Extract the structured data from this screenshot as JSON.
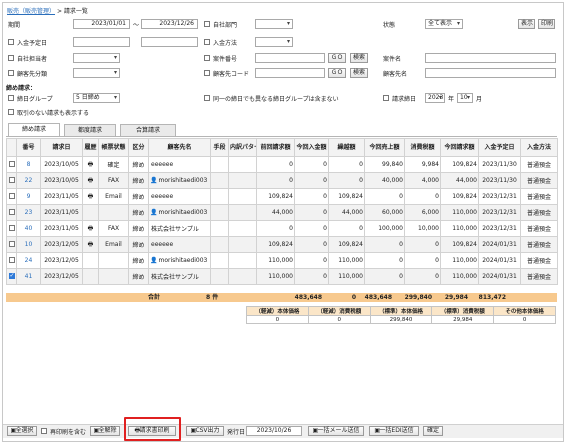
{
  "breadcrumb": {
    "root": "販売（販売管理）",
    "separator": ">",
    "current": "請求一覧"
  },
  "filters": {
    "period_label": "期間",
    "period_from": "2023/01/01",
    "period_tilde": "～",
    "period_to": "2023/12/26",
    "own_dept_label": "自社部門",
    "status_label": "状態",
    "status_value": "全て表示",
    "show_button": "表示",
    "print_button": "印刷",
    "payment_due_label": "入金予定日",
    "payment_method_label": "入金方法",
    "own_staff_label": "自社担当者",
    "case_no_label": "案件番号",
    "go_label": "ＧＯ",
    "search_label": "検索",
    "case_name_label": "案件名",
    "customer_class_label": "顧客先分類",
    "customer_code_label": "顧客先コード",
    "customer_name_label": "顧客先名",
    "closing_title": "締め請求：",
    "closing_group_label": "締日グループ",
    "closing_group_value": "5 日締め",
    "same_closing_label": "同一の締日でも異なる締日グループは含まない",
    "billing_closing_label": "請求締日",
    "year_value": "2023",
    "year_unit": "年",
    "month_value": "10",
    "month_unit": "月",
    "no_transaction_label": "取引のない請求も表示する"
  },
  "tabs": [
    "締め請求",
    "都度請求",
    "合算請求"
  ],
  "table": {
    "headers": [
      "",
      "番号",
      "請求日",
      "履歴",
      "帳票状態",
      "区分",
      "顧客先名",
      "手段",
      "内訳パターン",
      "前回請求額",
      "今回入金額",
      "繰越額",
      "今回売上額",
      "消費税額",
      "今回請求額",
      "入金予定日",
      "入金方法"
    ],
    "rows": [
      {
        "no": "8",
        "date": "2023/10/05",
        "hist": "🖶",
        "state": "確定",
        "div": "締め",
        "icon": "",
        "customer": "eeeeee",
        "prev": "0",
        "paid": "0",
        "carry": "0",
        "sales": "99,840",
        "tax": "9,984",
        "bill": "109,824",
        "due": "2023/11/30",
        "method": "普通預金"
      },
      {
        "no": "22",
        "date": "2023/10/05",
        "hist": "🖶",
        "state": "FAX",
        "div": "締め",
        "icon": "👤",
        "customer": "morishitaedi003",
        "prev": "0",
        "paid": "0",
        "carry": "0",
        "sales": "40,000",
        "tax": "4,000",
        "bill": "44,000",
        "due": "2023/11/30",
        "method": "普通預金"
      },
      {
        "no": "9",
        "date": "2023/11/05",
        "hist": "🖶",
        "state": "Email",
        "div": "締め",
        "icon": "",
        "customer": "eeeeee",
        "prev": "109,824",
        "paid": "0",
        "carry": "109,824",
        "sales": "0",
        "tax": "0",
        "bill": "109,824",
        "due": "2023/12/31",
        "method": "普通預金"
      },
      {
        "no": "23",
        "date": "2023/11/05",
        "hist": "",
        "state": "",
        "div": "締め",
        "icon": "👤",
        "customer": "morishitaedi003",
        "prev": "44,000",
        "paid": "0",
        "carry": "44,000",
        "sales": "60,000",
        "tax": "6,000",
        "bill": "110,000",
        "due": "2023/12/31",
        "method": "普通預金"
      },
      {
        "no": "40",
        "date": "2023/11/05",
        "hist": "🖶",
        "state": "FAX",
        "div": "締め",
        "icon": "",
        "customer": "株式会社サンプル",
        "prev": "0",
        "paid": "0",
        "carry": "0",
        "sales": "100,000",
        "tax": "10,000",
        "bill": "110,000",
        "due": "2023/12/31",
        "method": "普通預金"
      },
      {
        "no": "10",
        "date": "2023/12/05",
        "hist": "🖶",
        "state": "Email",
        "div": "締め",
        "icon": "",
        "customer": "eeeeee",
        "prev": "109,824",
        "paid": "0",
        "carry": "109,824",
        "sales": "0",
        "tax": "0",
        "bill": "109,824",
        "due": "2024/01/31",
        "method": "普通預金"
      },
      {
        "no": "24",
        "date": "2023/12/05",
        "hist": "",
        "state": "",
        "div": "締め",
        "icon": "👤",
        "customer": "morishitaedi003",
        "prev": "110,000",
        "paid": "0",
        "carry": "110,000",
        "sales": "0",
        "tax": "0",
        "bill": "110,000",
        "due": "2024/01/31",
        "method": "普通預金"
      },
      {
        "no": "41",
        "date": "2023/12/05",
        "hist": "",
        "state": "",
        "div": "締め",
        "icon": "",
        "customer": "株式会社サンプル",
        "prev": "110,000",
        "paid": "0",
        "carry": "110,000",
        "sales": "0",
        "tax": "0",
        "bill": "110,000",
        "due": "2024/01/31",
        "method": "普通預金"
      }
    ]
  },
  "totals": {
    "label": "合計",
    "count": "8 件",
    "prev": "483,648",
    "paid": "0",
    "carry": "483,648",
    "sales": "299,840",
    "tax": "29,984",
    "bill": "813,472"
  },
  "summary": {
    "headers": [
      "（軽減）本体価格",
      "（軽減）消費税額",
      "（標準）本体価格",
      "（標準）消費税額",
      "その他本体価格"
    ],
    "values": [
      "0",
      "0",
      "299,840",
      "29,984",
      "0"
    ]
  },
  "bottom": {
    "select_all": "全選択",
    "include_reissue": "再印刷を含む",
    "deselect_all": "全解除",
    "print_invoice": "請求書印刷",
    "csv_export": "CSV出力",
    "issue_date_label": "発行日",
    "issue_date": "2023/10/26",
    "batch_mail": "一括メール送信",
    "batch_edi": "一括EDI送信",
    "confirm": "確定"
  }
}
